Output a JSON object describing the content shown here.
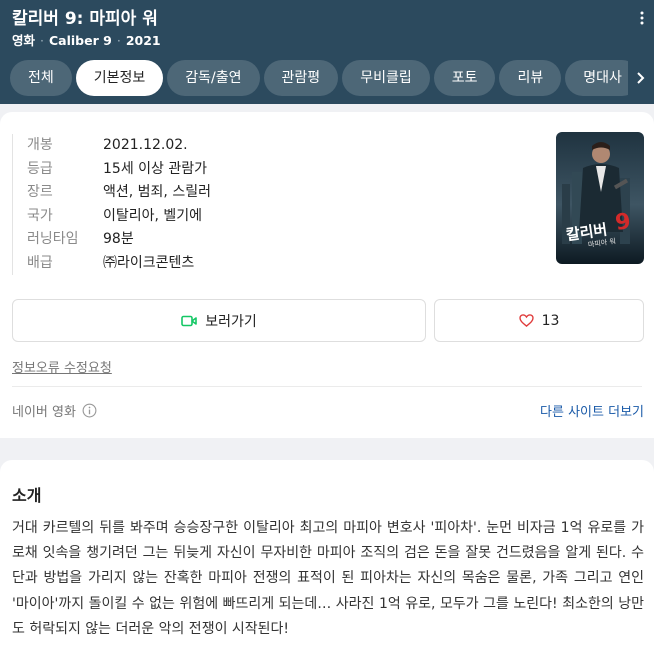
{
  "header": {
    "title": "칼리버 9: 마피아 워",
    "meta": [
      "영화",
      "Caliber 9",
      "2021"
    ]
  },
  "tabs": [
    "전체",
    "기본정보",
    "감독/출연",
    "관람평",
    "무비클립",
    "포토",
    "리뷰",
    "명대사"
  ],
  "active_tab": "기본정보",
  "info": [
    {
      "label": "개봉",
      "value": "2021.12.02."
    },
    {
      "label": "등급",
      "value": "15세 이상 관람가"
    },
    {
      "label": "장르",
      "value": "액션, 범죄, 스릴러"
    },
    {
      "label": "국가",
      "value": "이탈리아, 벨기에"
    },
    {
      "label": "러닝타임",
      "value": "98분"
    },
    {
      "label": "배급",
      "value": "㈜라이크콘텐츠"
    }
  ],
  "poster": {
    "title": "칼리버",
    "number": "9",
    "subtitle": "마피아 워"
  },
  "actions": {
    "watch_label": "보러가기",
    "like_count": "13"
  },
  "report_link": "정보오류 수정요청",
  "source_label": "네이버 영화",
  "other_sites_link": "다른 사이트 더보기",
  "intro": {
    "heading": "소개",
    "text": "거대 카르텔의 뒤를 봐주며 승승장구한 이탈리아 최고의 마피아 변호사 '피아차'. 눈먼 비자금 1억 유로를 가로채 잇속을 챙기려던 그는 뒤늦게 자신이 무자비한 마피아 조직의 검은 돈을 잘못 건드렸음을 알게 된다. 수단과 방법을 가리지 않는 잔혹한 마피아 전쟁의 표적이 된 피아차는 자신의 목숨은 물론, 가족 그리고 연인 '마이아'까지 돌이킬 수 없는 위험에 빠뜨리게 되는데… 사라진 1억 유로, 모두가 그를 노린다! 최소한의 낭만도 허락되지 않는 더러운 악의 전쟁이 시작된다!"
  },
  "colors": {
    "header_bg": "#2c4a5e",
    "link": "#1a5aa8",
    "watch_icon": "#14c765",
    "heart": "#e03c3c"
  }
}
